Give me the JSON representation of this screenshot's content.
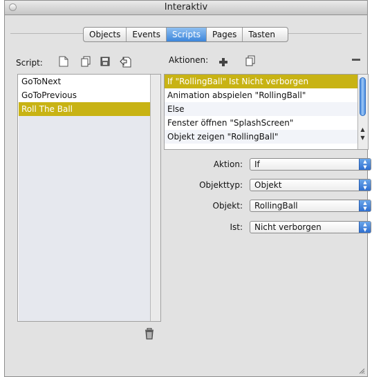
{
  "window": {
    "title": "Interaktiv"
  },
  "tabs": [
    {
      "label": "Objects",
      "active": false
    },
    {
      "label": "Events",
      "active": false
    },
    {
      "label": "Scripts",
      "active": true
    },
    {
      "label": "Pages",
      "active": false
    },
    {
      "label": "Tasten",
      "active": false
    }
  ],
  "script_section": {
    "label": "Script:",
    "items": [
      "GoToNext",
      "GoToPrevious",
      "Roll The Ball"
    ],
    "selected_item": "Roll The Ball"
  },
  "actions_section": {
    "label": "Aktionen:",
    "items": [
      "If  \"RollingBall\"  Ist  Nicht verborgen",
      "Animation abspielen  \"RollingBall\"",
      "Else",
      "Fenster öffnen  \"SplashScreen\"",
      "Objekt zeigen  \"RollingBall\""
    ],
    "selected_item": "If  \"RollingBall\"  Ist  Nicht verborgen"
  },
  "fields": {
    "aktion": {
      "label": "Aktion:",
      "value": "If"
    },
    "objekttyp": {
      "label": "Objekttyp:",
      "value": "Objekt"
    },
    "objekt": {
      "label": "Objekt:",
      "value": "RollingBall"
    },
    "ist": {
      "label": "Ist:",
      "value": "Nicht verborgen"
    }
  },
  "colors": {
    "selection": "#c8b314",
    "accent_blue": "#3d86db",
    "panel_bg": "#e2e2e2"
  },
  "icons": [
    "close-icon",
    "new-script-icon",
    "duplicate-script-icon",
    "save-script-icon",
    "load-script-icon",
    "add-action-icon",
    "duplicate-action-icon",
    "remove-action-icon",
    "trash-icon",
    "resize-grip-icon"
  ]
}
